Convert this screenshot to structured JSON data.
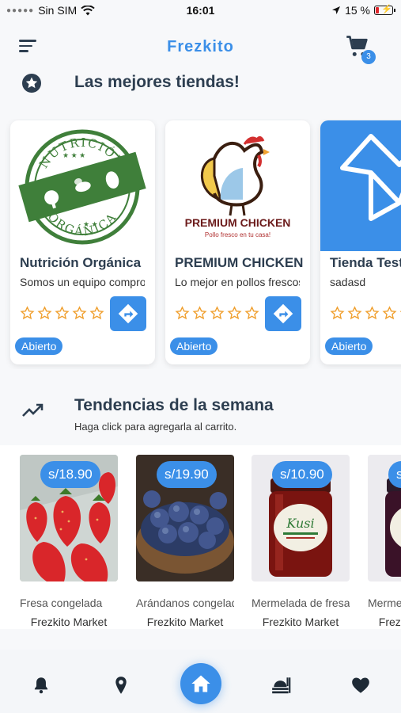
{
  "status": {
    "carrier": "Sin SIM",
    "time": "16:01",
    "battery": "15 %"
  },
  "app": {
    "title": "Frezkito",
    "cart_count": "3"
  },
  "stores_section": {
    "title": "Las mejores tiendas!"
  },
  "stores": [
    {
      "name": "Nutrición Orgánica",
      "desc": "Somos un equipo comprometido",
      "status": "Abierto",
      "logo_text_top": "NUTRICIÓN",
      "logo_text_bottom": "ORGÁNICA"
    },
    {
      "name": "PREMIUM CHICKEN",
      "desc": "Lo mejor en pollos frescos",
      "status": "Abierto",
      "logo_text": "PREMIUM CHICKEN",
      "logo_tagline": "Pollo fresco en tu casa!"
    },
    {
      "name": "Tienda Test",
      "desc": "sadasd",
      "status": "Abierto"
    }
  ],
  "trending": {
    "title": "Tendencias de la semana",
    "subtitle": "Haga click para agregarla al carrito."
  },
  "products": [
    {
      "price": "s/18.90",
      "name": "Fresa congelada",
      "store": "Frezkito Market"
    },
    {
      "price": "s/19.90",
      "name": "Arándanos congelados",
      "store": "Frezkito Market"
    },
    {
      "price": "s/10.90",
      "name": "Mermelada de fresa",
      "store": "Frezkito Market",
      "label_text": "Kusi"
    },
    {
      "price": "s/",
      "name": "Mermelada",
      "store": "Frezkito Market"
    }
  ],
  "colors": {
    "accent": "#3b8fe8",
    "heading": "#2d3e50",
    "star": "#f0a030",
    "logo_green": "#3f7f3a",
    "chicken_red": "#8b1a1a"
  }
}
